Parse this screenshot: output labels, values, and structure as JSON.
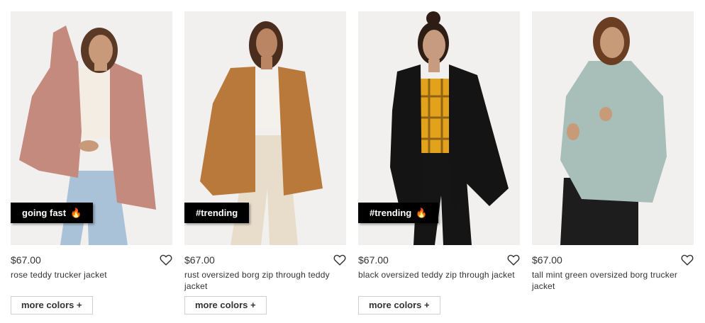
{
  "products": [
    {
      "badge": "going fast",
      "badge_icon": "flame-icon",
      "price": "$67.00",
      "name": "rose teddy trucker jacket",
      "more_label": "more colors +",
      "jacket_color": "#c48a7e",
      "top_color": "#f3ede4",
      "pants_color": "#a9c2d8",
      "hair_color": "#5a3a26",
      "skin_color": "#c99a7a"
    },
    {
      "badge": "#trending",
      "badge_icon": "",
      "price": "$67.00",
      "name": "rust oversized borg zip through teddy jacket",
      "more_label": "more colors +",
      "jacket_color": "#b8793a",
      "top_color": "#f4f1ec",
      "pants_color": "#e8ddcb",
      "hair_color": "#4a2d1c",
      "skin_color": "#b98562"
    },
    {
      "badge": "#trending",
      "badge_icon": "flame-icon",
      "price": "$67.00",
      "name": "black oversized teddy zip through jacket",
      "more_label": "more colors +",
      "jacket_color": "#141414",
      "top_color": "#e3a21c",
      "pants_color": "#151515",
      "hair_color": "#2d1d14",
      "skin_color": "#c79b7f"
    },
    {
      "badge": "",
      "badge_icon": "",
      "price": "$67.00",
      "name": "tall mint green oversized borg trucker jacket",
      "more_label": "",
      "jacket_color": "#a7bfb8",
      "top_color": "#a7bfb8",
      "pants_color": "#1d1d1d",
      "hair_color": "#6a3e22",
      "skin_color": "#c79a78"
    }
  ]
}
